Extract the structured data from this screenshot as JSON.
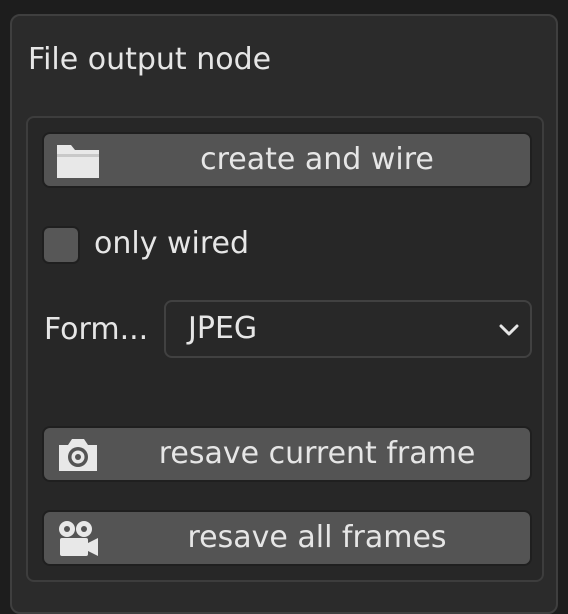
{
  "panel": {
    "title": "File output node"
  },
  "buttons": {
    "create_wire": {
      "label": "create and wire",
      "icon": "folder-icon"
    },
    "resave_current": {
      "label": "resave current frame",
      "icon": "camera-icon"
    },
    "resave_all": {
      "label": "resave all frames",
      "icon": "movie-camera-icon"
    }
  },
  "only_wired": {
    "label": "only wired",
    "checked": false
  },
  "format": {
    "label": "Form...",
    "value": "JPEG"
  },
  "colors": {
    "panel_bg": "#2b2b2b",
    "button_bg": "#545454",
    "text": "#e6e6e6"
  }
}
